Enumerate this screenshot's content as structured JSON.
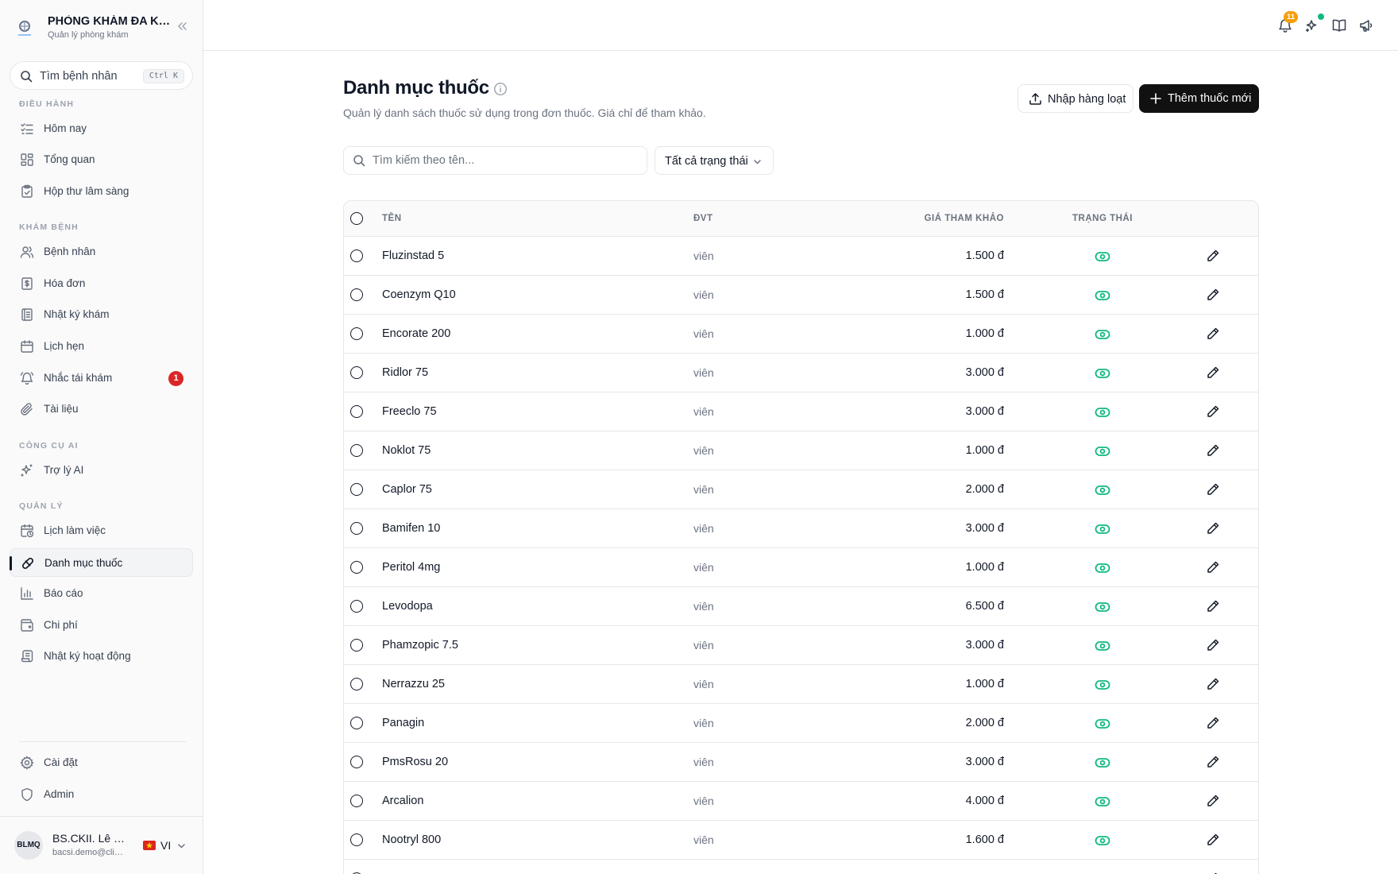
{
  "sidebar": {
    "brand": {
      "title": "PHÒNG KHÁM ĐA KHOA",
      "subtitle": "Quản lý phòng khám"
    },
    "search": {
      "label": "Tìm bệnh nhân",
      "shortcut": "Ctrl K"
    },
    "sections": [
      {
        "label": "ĐIỀU HÀNH",
        "items": [
          {
            "label": "Hôm nay",
            "icon": "list-check-icon"
          },
          {
            "label": "Tổng quan",
            "icon": "dashboard-icon"
          },
          {
            "label": "Hộp thư lâm sàng",
            "icon": "clipboard-check-icon"
          }
        ]
      },
      {
        "label": "KHÁM BỆNH",
        "items": [
          {
            "label": "Bệnh nhân",
            "icon": "users-icon"
          },
          {
            "label": "Hóa đơn",
            "icon": "invoice-icon"
          },
          {
            "label": "Nhật ký khám",
            "icon": "notebook-icon"
          },
          {
            "label": "Lịch hẹn",
            "icon": "calendar-icon"
          },
          {
            "label": "Nhắc tái khám",
            "icon": "bell-ring-icon",
            "badge": "1"
          },
          {
            "label": "Tài liệu",
            "icon": "paperclip-icon"
          }
        ]
      },
      {
        "label": "CÔNG CỤ AI",
        "items": [
          {
            "label": "Trợ lý AI",
            "icon": "sparkles-icon"
          }
        ]
      },
      {
        "label": "QUẢN LÝ",
        "items": [
          {
            "label": "Lịch làm việc",
            "icon": "calendar-clock-icon"
          },
          {
            "label": "Danh mục thuốc",
            "icon": "pill-icon",
            "active": true
          },
          {
            "label": "Báo cáo",
            "icon": "bar-chart-icon"
          },
          {
            "label": "Chi phí",
            "icon": "wallet-icon"
          },
          {
            "label": "Nhật ký hoạt động",
            "icon": "scroll-icon"
          }
        ]
      }
    ],
    "bottom_items": [
      {
        "label": "Cài đặt",
        "icon": "gear-icon"
      },
      {
        "label": "Admin",
        "icon": "shield-icon"
      }
    ],
    "user": {
      "initials": "BLMQ",
      "name": "BS.CKII. Lê Minh Quân",
      "email": "bacsi.demo@clinic.vn",
      "lang": "VI"
    }
  },
  "topbar": {
    "notification_count": "11"
  },
  "page": {
    "title": "Danh mục thuốc",
    "subtitle": "Quản lý danh sách thuốc sử dụng trong đơn thuốc. Giá chỉ để tham khảo.",
    "import_button": "Nhập hàng loạt",
    "add_button": "Thêm thuốc mới",
    "search_placeholder": "Tìm kiếm theo tên...",
    "status_filter": "Tất cả trạng thái"
  },
  "table": {
    "columns": {
      "name": "TÊN",
      "unit": "ĐVT",
      "price": "GIÁ THAM KHẢO",
      "status": "TRẠNG THÁI"
    },
    "rows": [
      {
        "name": "Fluzinstad 5",
        "unit": "viên",
        "price": "1.500 đ"
      },
      {
        "name": "Coenzym Q10",
        "unit": "viên",
        "price": "1.500 đ"
      },
      {
        "name": "Encorate 200",
        "unit": "viên",
        "price": "1.000 đ"
      },
      {
        "name": "Ridlor 75",
        "unit": "viên",
        "price": "3.000 đ"
      },
      {
        "name": "Freeclo 75",
        "unit": "viên",
        "price": "3.000 đ"
      },
      {
        "name": "Noklot 75",
        "unit": "viên",
        "price": "1.000 đ"
      },
      {
        "name": "Caplor 75",
        "unit": "viên",
        "price": "2.000 đ"
      },
      {
        "name": "Bamifen 10",
        "unit": "viên",
        "price": "3.000 đ"
      },
      {
        "name": "Peritol 4mg",
        "unit": "viên",
        "price": "1.000 đ"
      },
      {
        "name": "Levodopa",
        "unit": "viên",
        "price": "6.500 đ"
      },
      {
        "name": "Phamzopic 7.5",
        "unit": "viên",
        "price": "3.000 đ"
      },
      {
        "name": "Nerrazzu 25",
        "unit": "viên",
        "price": "1.000 đ"
      },
      {
        "name": "Panagin",
        "unit": "viên",
        "price": "2.000 đ"
      },
      {
        "name": "PmsRosu 20",
        "unit": "viên",
        "price": "3.000 đ"
      },
      {
        "name": "Arcalion",
        "unit": "viên",
        "price": "4.000 đ"
      },
      {
        "name": "Nootryl 800",
        "unit": "viên",
        "price": "1.600 đ"
      },
      {
        "name": "",
        "unit": "",
        "price": ""
      }
    ]
  }
}
